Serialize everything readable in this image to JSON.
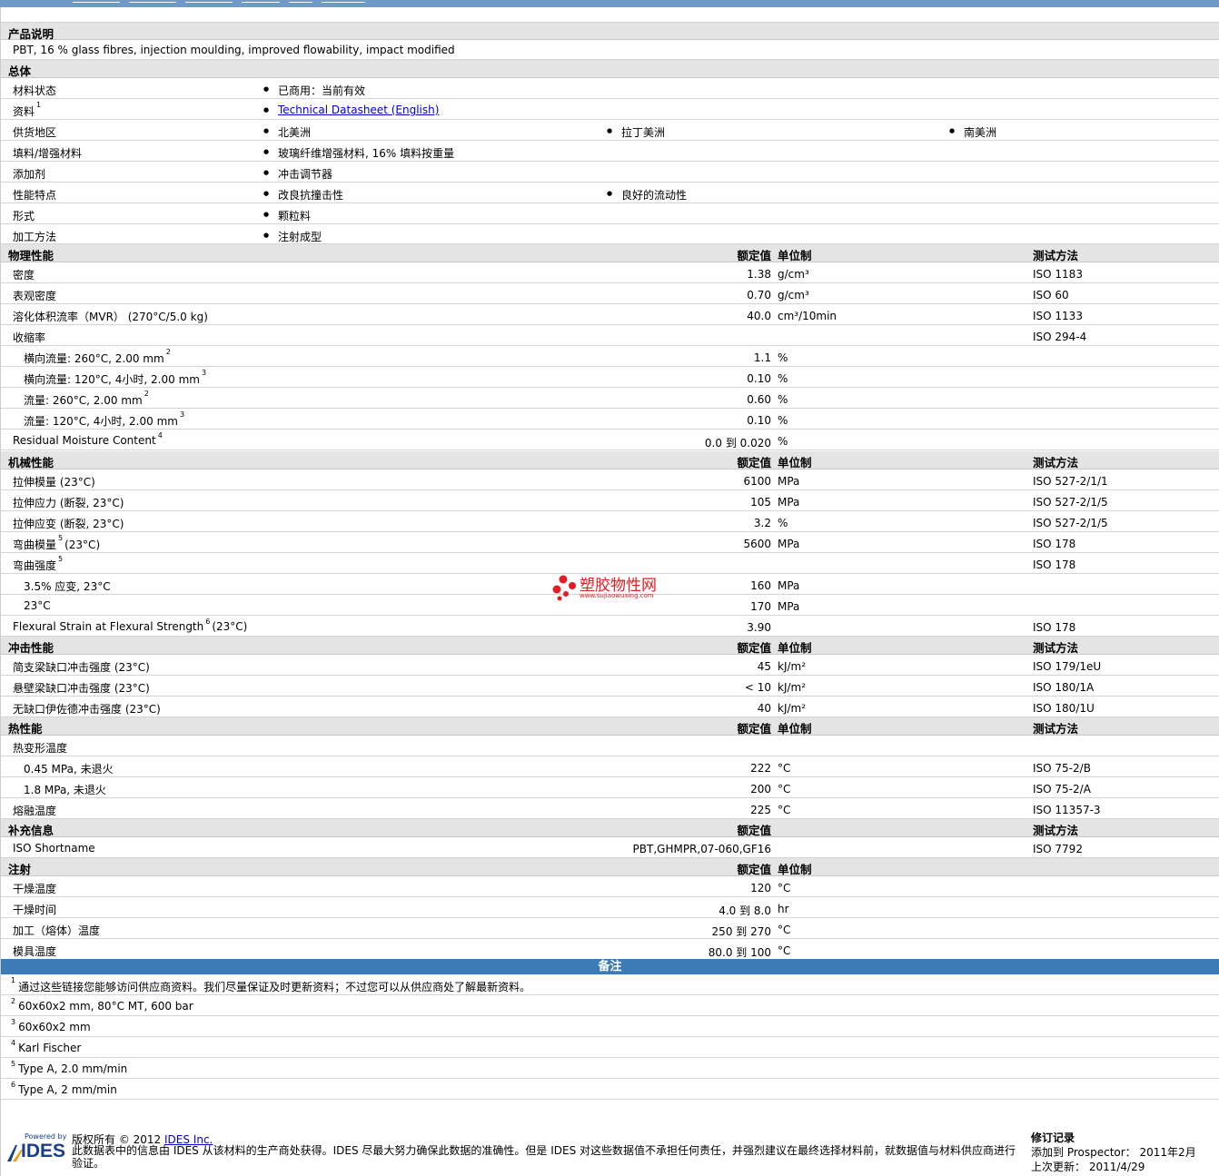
{
  "product_desc": {
    "header": "产品说明",
    "text": "PBT, 16 % glass fibres, injection moulding, improved flowability, impact modified"
  },
  "general": {
    "header": "总体",
    "material_status_label": "材料状态",
    "material_status": "已商用：当前有效",
    "datasheet_label": "资料",
    "datasheet_sup": "1",
    "datasheet_link": "Technical Datasheet (English)",
    "supply_label": "供货地区",
    "supply": [
      "北美洲",
      "拉丁美洲",
      "南美洲"
    ],
    "filler_label": "填料/增强材料",
    "filler": "玻璃纤维增强材料, 16% 填料按重量",
    "additive_label": "添加剂",
    "additive": "冲击调节器",
    "features_label": "性能特点",
    "features": [
      "改良抗撞击性",
      "良好的流动性"
    ],
    "form_label": "形式",
    "form": "颗粒料",
    "process_label": "加工方法",
    "process": "注射成型"
  },
  "col_headers": {
    "value": "额定值",
    "unit": "单位制",
    "test": "测试方法"
  },
  "physical": {
    "header": "物理性能",
    "rows": [
      {
        "label": "密度",
        "value": "1.38",
        "unit": "g/cm³",
        "test": "ISO 1183"
      },
      {
        "label": "表观密度",
        "value": "0.70",
        "unit": "g/cm³",
        "test": "ISO 60"
      },
      {
        "label": "溶化体积流率（MVR） (270°C/5.0 kg)",
        "value": "40.0",
        "unit": "cm³/10min",
        "test": "ISO 1133"
      },
      {
        "label": "收缩率",
        "value": "",
        "unit": "",
        "test": "ISO 294-4"
      },
      {
        "label": "横向流量: 260°C, 2.00 mm",
        "sup": "2",
        "value": "1.1",
        "unit": "%",
        "test": ""
      },
      {
        "label": "横向流量: 120°C, 4小时, 2.00 mm",
        "sup": "3",
        "value": "0.10",
        "unit": "%",
        "test": ""
      },
      {
        "label": "流量: 260°C, 2.00 mm",
        "sup": "2",
        "value": "0.60",
        "unit": "%",
        "test": ""
      },
      {
        "label": "流量: 120°C, 4小时, 2.00 mm",
        "sup": "3",
        "value": "0.10",
        "unit": "%",
        "test": ""
      },
      {
        "label": "Residual Moisture Content",
        "sup": "4",
        "value": "0.0 到  0.020",
        "unit": "%",
        "test": ""
      }
    ]
  },
  "mechanical": {
    "header": "机械性能",
    "rows": [
      {
        "label": "拉伸模量 (23°C)",
        "value": "6100",
        "unit": "MPa",
        "test": "ISO 527-2/1/1"
      },
      {
        "label": "拉伸应力 (断裂, 23°C)",
        "value": "105",
        "unit": "MPa",
        "test": "ISO 527-2/1/5"
      },
      {
        "label": "拉伸应变 (断裂, 23°C)",
        "value": "3.2",
        "unit": "%",
        "test": "ISO 527-2/1/5"
      },
      {
        "label": "弯曲模量",
        "sup": "5",
        "label2": "(23°C)",
        "value": "5600",
        "unit": "MPa",
        "test": "ISO 178"
      },
      {
        "label": "弯曲强度",
        "sup": "5",
        "value": "",
        "unit": "",
        "test": "ISO 178"
      },
      {
        "label": "3.5% 应变, 23°C",
        "value": "160",
        "unit": "MPa",
        "test": ""
      },
      {
        "label": "23°C",
        "value": "170",
        "unit": "MPa",
        "test": ""
      },
      {
        "label": "Flexural Strain at Flexural Strength",
        "sup": "6",
        "label2": "(23°C)",
        "value": "3.90",
        "unit": "",
        "test": "ISO 178"
      }
    ]
  },
  "impact": {
    "header": "冲击性能",
    "rows": [
      {
        "label": "简支梁缺口冲击强度 (23°C)",
        "value": "45",
        "unit": "kJ/m²",
        "test": "ISO 179/1eU"
      },
      {
        "label": "悬壁梁缺口冲击强度 (23°C)",
        "value": "< 10",
        "unit": "kJ/m²",
        "test": "ISO 180/1A"
      },
      {
        "label": "无缺口伊佐德冲击强度 (23°C)",
        "value": "40",
        "unit": "kJ/m²",
        "test": "ISO 180/1U"
      }
    ]
  },
  "thermal": {
    "header": "热性能",
    "rows": [
      {
        "label": "热变形温度",
        "value": "",
        "unit": "",
        "test": ""
      },
      {
        "label": "0.45 MPa, 未退火",
        "value": "222",
        "unit": "°C",
        "test": "ISO 75-2/B"
      },
      {
        "label": "1.8 MPa, 未退火",
        "value": "200",
        "unit": "°C",
        "test": "ISO 75-2/A"
      },
      {
        "label": "熔融温度",
        "value": "225",
        "unit": "°C",
        "test": "ISO 11357-3"
      }
    ]
  },
  "supplement": {
    "header": "补充信息",
    "rows": [
      {
        "label": "ISO Shortname",
        "value": "PBT,GHMPR,07-060,GF16",
        "unit": "",
        "test": "ISO 7792"
      }
    ]
  },
  "injection": {
    "header": "注射",
    "rows": [
      {
        "label": "干燥温度",
        "value": "120",
        "unit": "°C",
        "test": ""
      },
      {
        "label": "干燥时间",
        "value": "4.0 到  8.0",
        "unit": "hr",
        "test": ""
      },
      {
        "label": "加工（熔体）温度",
        "value": "250 到  270",
        "unit": "°C",
        "test": ""
      },
      {
        "label": "模具温度",
        "value": "80.0 到  100",
        "unit": "°C",
        "test": ""
      }
    ]
  },
  "notes": {
    "header": "备注",
    "items": [
      {
        "n": "1",
        "text": "通过这些链接您能够访问供应商资料。我们尽量保证及时更新资料；不过您可以从供应商处了解最新资料。"
      },
      {
        "n": "2",
        "text": "60x60x2 mm, 80°C MT, 600 bar"
      },
      {
        "n": "3",
        "text": "60x60x2 mm"
      },
      {
        "n": "4",
        "text": "Karl Fischer"
      },
      {
        "n": "5",
        "text": "Type A, 2.0 mm/min"
      },
      {
        "n": "6",
        "text": "Type A, 2 mm/min"
      }
    ]
  },
  "watermark": {
    "title": "塑胶物性网",
    "url": "www.sujiaowuxing.com"
  },
  "footer": {
    "powered_by": "Powered by",
    "logo": "IDES",
    "copyright_prefix": "版权所有  © 2012",
    "copyright_link": "IDES Inc.",
    "disclaimer": "此数据表中的信息由  IDES 从该材料的生产商处获得。IDES 尽最大努力确保此数据的准确性。但是  IDES 对这些数据值不承担任何责任，并强烈建议在最终选择材料前，就数据值与材料供应商进行验证。",
    "rev_title": "修订记录",
    "rev_added_label": "添加到  Prospector：",
    "rev_added": "2011年2月",
    "rev_updated_label": "上次更新：",
    "rev_updated": "2011/4/29"
  },
  "colors": {
    "header_bar": "#3c7bb5",
    "section_bg": "#e4e4e4",
    "link": "#0000cc",
    "watermark": "#e21d24",
    "logo": "#1a3f86"
  }
}
